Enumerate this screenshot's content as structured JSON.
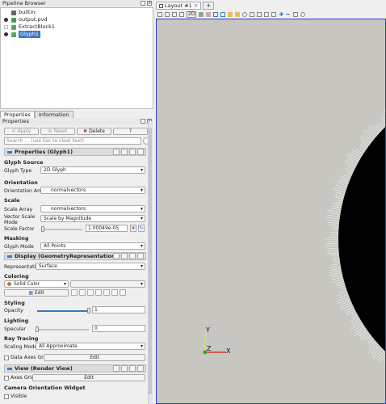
{
  "pipeline_browser": {
    "title": "Pipeline Browser",
    "items": [
      {
        "label": "builtin:",
        "visible": false,
        "icon": "server-icon"
      },
      {
        "label": "output.pvd",
        "visible": true,
        "icon": "source-icon"
      },
      {
        "label": "ExtractBlock1",
        "visible": false,
        "icon": "filter-icon"
      },
      {
        "label": "Glyph1",
        "visible": true,
        "icon": "filter-icon",
        "selected": true
      }
    ]
  },
  "panel_tabs": [
    "Properties",
    "Information"
  ],
  "properties": {
    "title": "Properties",
    "apply_label": "Apply",
    "reset_label": "Reset",
    "delete_label": "Delete",
    "help_label": "?",
    "search_placeholder": "Search ... (use Esc to clear text)",
    "properties_header": "Properties (Glyph1)",
    "glyph_source_group": "Glyph Source",
    "glyph_type_label": "Glyph Type",
    "glyph_type_value": "2D Glyph",
    "orientation_group": "Orientation",
    "orientation_array_label": "Orientation Array",
    "orientation_array_value": "normalvectors",
    "scale_group": "Scale",
    "scale_array_label": "Scale Array",
    "scale_array_value": "normalvectors",
    "vector_scale_mode_label": "Vector Scale Mode",
    "vector_scale_mode_value": "Scale by Magnitude",
    "scale_factor_label": "Scale Factor",
    "scale_factor_value": "1.00049e-05",
    "masking_group": "Masking",
    "glyph_mode_label": "Glyph Mode",
    "glyph_mode_value": "All Points",
    "display_header": "Display (GeometryRepresentation)",
    "representation_label": "Representation",
    "representation_value": "Surface",
    "coloring_group": "Coloring",
    "coloring_value": "Solid Color",
    "edit_label": "Edit",
    "styling_group": "Styling",
    "opacity_label": "Opacity",
    "opacity_value": "1",
    "opacity_fraction": 1.0,
    "lighting_group": "Lighting",
    "specular_label": "Specular",
    "specular_value": "0",
    "specular_fraction": 0.0,
    "ray_tracing_group": "Ray Tracing",
    "scaling_mode_label": "Scaling Mode",
    "scaling_mode_value": "All Approximate",
    "data_axes_grid_label": "Data Axes Grid",
    "data_axes_edit_label": "Edit",
    "view_header": "View (Render View)",
    "axes_grid_label": "Axes Grid",
    "axes_grid_edit_label": "Edit",
    "camera_widget_group": "Camera Orientation Widget",
    "visible_label": "Visible"
  },
  "layout_tabs": {
    "tab_label": "Layout #1",
    "add_label": "+"
  },
  "toolbar": {
    "label_2d": "2D"
  },
  "viewport": {
    "background": "#c7c6c0",
    "accent_border": "#2f3cd6",
    "axes": {
      "y_label": "Y",
      "z_label": "Z",
      "x_label": "X"
    }
  },
  "colors": {
    "selection": "#3a78c8",
    "section_toggle": "#3a78c8"
  }
}
